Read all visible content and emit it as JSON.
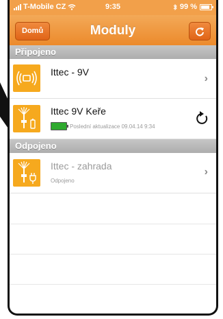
{
  "status_bar": {
    "carrier": "T-Mobile CZ",
    "time": "9:35",
    "battery": "99 %"
  },
  "nav": {
    "back_label": "Domů",
    "title": "Moduly"
  },
  "sections": {
    "connected_header": "Připojeno",
    "disconnected_header": "Odpojeno"
  },
  "modules": {
    "connected": [
      {
        "name": "Ittec - 9V"
      },
      {
        "name": "Ittec 9V Keře",
        "status": "Poslední aktualizace 09.04.14 9:34",
        "battery_level": 1.0
      }
    ],
    "disconnected": [
      {
        "name": "Ittec - zahrada",
        "status": "Odpojeno"
      }
    ]
  },
  "colors": {
    "accent": "#ec8a2c",
    "tile": "#f6a91e",
    "battery": "#2faa2f"
  }
}
